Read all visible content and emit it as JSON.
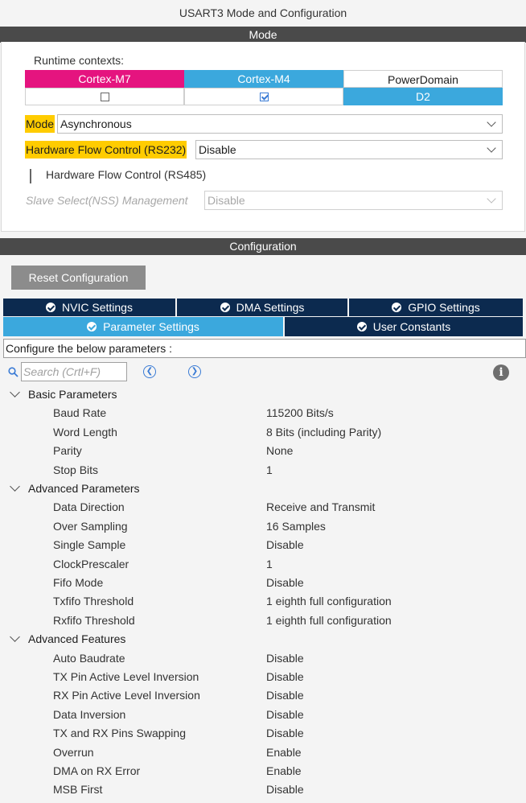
{
  "window_title": "USART3 Mode and Configuration",
  "mode_section": {
    "header": "Mode",
    "runtime_label": "Runtime contexts:",
    "contexts": [
      {
        "name": "Cortex-M7",
        "color": "#e5147f",
        "checked": false
      },
      {
        "name": "Cortex-M4",
        "color": "#3ba8dd",
        "checked": true
      },
      {
        "name": "PowerDomain",
        "value": "D2",
        "value_color": "#3ba8dd"
      }
    ],
    "mode_label": "Mode",
    "mode_value": "Asynchronous",
    "hwfc232_label": "Hardware Flow Control (RS232)",
    "hwfc232_value": "Disable",
    "hwfc485_label": "Hardware Flow Control (RS485)",
    "nss_label": "Slave Select(NSS) Management",
    "nss_value": "Disable",
    "highlight_color": "#ffcc00"
  },
  "config_section": {
    "header": "Configuration",
    "reset_button": "Reset Configuration",
    "tabs_row1": [
      "NVIC Settings",
      "DMA Settings",
      "GPIO Settings"
    ],
    "tabs_row2": [
      "Parameter Settings",
      "User Constants"
    ],
    "active_tab": "Parameter Settings",
    "configure_text": "Configure the below parameters :",
    "search_placeholder": "Search (Crtl+F)",
    "groups": [
      {
        "name": "Basic Parameters",
        "params": [
          {
            "key": "Baud Rate",
            "value": "115200 Bits/s"
          },
          {
            "key": "Word Length",
            "value": "8 Bits (including Parity)"
          },
          {
            "key": "Parity",
            "value": "None"
          },
          {
            "key": "Stop Bits",
            "value": "1"
          }
        ]
      },
      {
        "name": "Advanced Parameters",
        "params": [
          {
            "key": "Data Direction",
            "value": "Receive and Transmit"
          },
          {
            "key": "Over Sampling",
            "value": "16 Samples"
          },
          {
            "key": "Single Sample",
            "value": "Disable"
          },
          {
            "key": "ClockPrescaler",
            "value": "1"
          },
          {
            "key": "Fifo Mode",
            "value": "Disable"
          },
          {
            "key": "Txfifo Threshold",
            "value": "1 eighth full configuration"
          },
          {
            "key": "Rxfifo Threshold",
            "value": "1 eighth full configuration"
          }
        ]
      },
      {
        "name": "Advanced Features",
        "params": [
          {
            "key": "Auto Baudrate",
            "value": "Disable"
          },
          {
            "key": "TX Pin Active Level Inversion",
            "value": "Disable"
          },
          {
            "key": "RX Pin Active Level Inversion",
            "value": "Disable"
          },
          {
            "key": "Data Inversion",
            "value": "Disable"
          },
          {
            "key": "TX and RX Pins Swapping",
            "value": "Disable"
          },
          {
            "key": "Overrun",
            "value": "Enable"
          },
          {
            "key": "DMA on RX Error",
            "value": "Enable"
          },
          {
            "key": "MSB First",
            "value": "Disable"
          }
        ]
      }
    ]
  }
}
